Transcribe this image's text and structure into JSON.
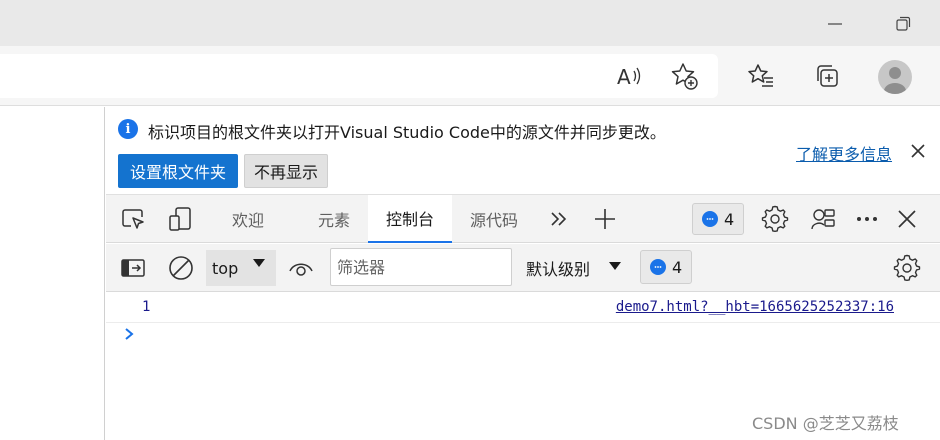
{
  "window": {
    "minimize_icon": "minimize-icon",
    "restore_icon": "restore-icon"
  },
  "browser_toolbar": {
    "icons": [
      "read-aloud-icon",
      "add-favorite-icon",
      "favorites-icon",
      "collections-icon",
      "profile-avatar"
    ]
  },
  "infobar": {
    "message": "标识项目的根文件夹以打开Visual Studio Code中的源文件并同步更改。",
    "primary_button": "设置根文件夹",
    "secondary_button": "不再显示",
    "learn_more": "了解更多信息"
  },
  "devtools": {
    "tabs": [
      {
        "label": "欢迎",
        "active": false
      },
      {
        "label": "元素",
        "active": false
      },
      {
        "label": "控制台",
        "active": true
      },
      {
        "label": "源代码",
        "active": false
      }
    ],
    "issues_count": "4"
  },
  "console": {
    "context": "top",
    "filter_placeholder": "筛选器",
    "level": "默认级别",
    "messages_count": "4",
    "rows": [
      {
        "value": "1",
        "source": "demo7.html?__hbt=1665625252337:16"
      }
    ]
  },
  "colors": {
    "accent": "#1a73e8",
    "primary_button": "#1473cf",
    "link": "#0b5cad"
  },
  "watermark": "CSDN @芝芝又荔枝"
}
